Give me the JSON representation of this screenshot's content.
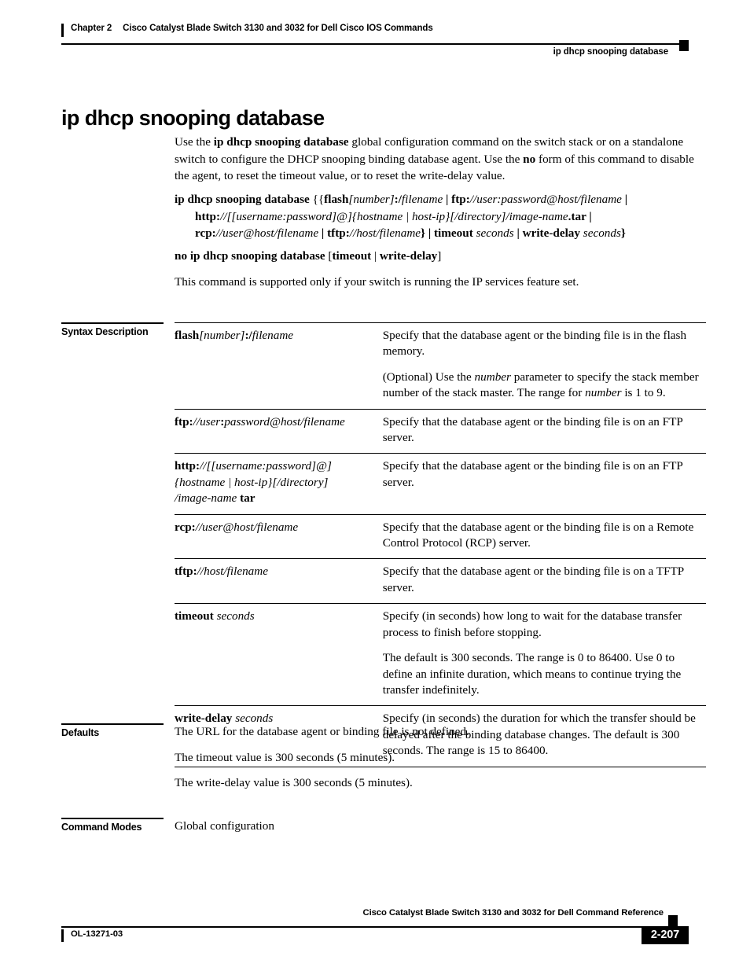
{
  "header": {
    "chapter": "Chapter 2",
    "chapter_title": "Cisco Catalyst Blade Switch 3130 and 3032 for Dell Cisco IOS Commands",
    "topic": "ip dhcp snooping database"
  },
  "title": "ip dhcp snooping database",
  "intro": {
    "t1": "Use the ",
    "b1": "ip dhcp snooping database",
    "t2": " global configuration command on the switch stack or on a standalone switch to configure the DHCP snooping binding database agent. Use the ",
    "b2": "no",
    "t3": " form of this command to disable the agent, to reset the timeout value, or to reset the write-delay value."
  },
  "syntax": {
    "line1": {
      "cmd": "ip dhcp snooping database",
      "open": " {{",
      "flash": "flash",
      "flash_num": "[number]",
      "flash_colon": ":/",
      "flash_file": "filename",
      "bar1": " | ",
      "ftp": "ftp:",
      "ftp_args": "//user:password@host/filename",
      "bar2": " |"
    },
    "line2": {
      "http": "http:",
      "http_args": "//[[username:password]@]{hostname | host-ip}[/directory]/image-name",
      "tar": ".tar",
      "bar": " |"
    },
    "line3": {
      "rcp": "rcp:",
      "rcp_args": "//user@host/filename",
      "bar1": " | ",
      "tftp": "tftp:",
      "tftp_args": "//host/filename",
      "close1": "} | ",
      "timeout": "timeout",
      "seconds1": " seconds",
      "bar2": " | ",
      "writedelay": "write-delay",
      "seconds2": " seconds",
      "close2": "}"
    },
    "no_form": {
      "cmd": "no ip dhcp snooping database",
      "open": " [",
      "timeout": "timeout",
      "bar": " | ",
      "writedelay": "write-delay",
      "close": "]"
    }
  },
  "support_note": "This command is supported only if your switch is running the IP services feature set.",
  "sections": {
    "syntax_description": "Syntax Description",
    "defaults": "Defaults",
    "command_modes": "Command Modes"
  },
  "syntax_table": {
    "rows": [
      {
        "term_lines": [
          {
            "bold": "flash",
            "italic": "[number]",
            "bold2": ":/",
            "italic2": "filename"
          }
        ],
        "desc": [
          "Specify that the database agent or the binding file is in the flash memory.",
          "(Optional) Use the number parameter to specify the stack member number of the stack master. The range for number is 1 to 9."
        ],
        "desc_html": [
          "Specify that the database agent or the binding file is in the flash memory.",
          "(Optional) Use the <i>number</i> parameter to specify the stack member number of the stack master. The range for <i>number</i> is 1 to 9."
        ]
      },
      {
        "term_lines": [
          {
            "bold": "ftp:",
            "italic": "//user",
            "bold2": ":",
            "italic2": "password@host/filename"
          }
        ],
        "desc": [
          "Specify that the database agent or the binding file is on an FTP server."
        ],
        "desc_html": [
          "Specify that the database agent or the binding file is on an FTP server."
        ]
      },
      {
        "term_lines": [
          {
            "bold": "http:",
            "italic": "//[[username:password]@]"
          },
          {
            "italic": "{hostname | host-ip}[/directory]"
          },
          {
            "italic": "/image-name ",
            "bold_tail": "tar"
          }
        ],
        "desc": [
          "Specify that the database agent or the binding file is on an FTP server."
        ],
        "desc_html": [
          "Specify that the database agent or the binding file is on an FTP server."
        ]
      },
      {
        "term_lines": [
          {
            "bold": "rcp:",
            "italic": "//user@host/filename"
          }
        ],
        "desc": [
          "Specify that the database agent or the binding file is on a Remote Control Protocol (RCP) server."
        ],
        "desc_html": [
          "Specify that the database agent or the binding file is on a Remote Control Protocol (RCP) server."
        ]
      },
      {
        "term_lines": [
          {
            "bold": "tftp:",
            "italic": "//host/filename"
          }
        ],
        "desc": [
          "Specify that the database agent or the binding file is on a TFTP server."
        ],
        "desc_html": [
          "Specify that the database agent or the binding file is on a TFTP server."
        ]
      },
      {
        "term_lines": [
          {
            "bold": "timeout",
            "italic": " seconds"
          }
        ],
        "desc": [
          "Specify (in seconds) how long to wait for the database transfer process to finish before stopping.",
          "The default is 300 seconds. The range is 0 to 86400. Use 0 to define an infinite duration, which means to continue trying the transfer indefinitely."
        ],
        "desc_html": [
          "Specify (in seconds) how long to wait for the database transfer process to finish before stopping.",
          "The default is 300 seconds. The range is 0 to 86400. Use 0 to define an infinite duration, which means to continue trying the transfer indefinitely."
        ]
      },
      {
        "term_lines": [
          {
            "bold": "write-delay",
            "italic": " seconds"
          }
        ],
        "desc": [
          "Specify (in seconds) the duration for which the transfer should be delayed after the binding database changes. The default is 300 seconds. The range is 15 to 86400."
        ],
        "desc_html": [
          "Specify (in seconds) the duration for which the transfer should be delayed after the binding database changes. The default is 300 seconds. The range is 15 to 86400."
        ]
      }
    ]
  },
  "defaults": {
    "lines": [
      "The URL for the database agent or binding file is not defined.",
      "The timeout value is 300 seconds (5 minutes).",
      "The write-delay value is 300 seconds (5 minutes)."
    ]
  },
  "command_modes": {
    "value": "Global configuration"
  },
  "footer": {
    "doc_id": "OL-13271-03",
    "book_title": "Cisco Catalyst Blade Switch 3130 and 3032 for Dell Command Reference",
    "page_number": "2-207"
  },
  "colors": {
    "ink": "#000000",
    "paper": "#ffffff"
  }
}
